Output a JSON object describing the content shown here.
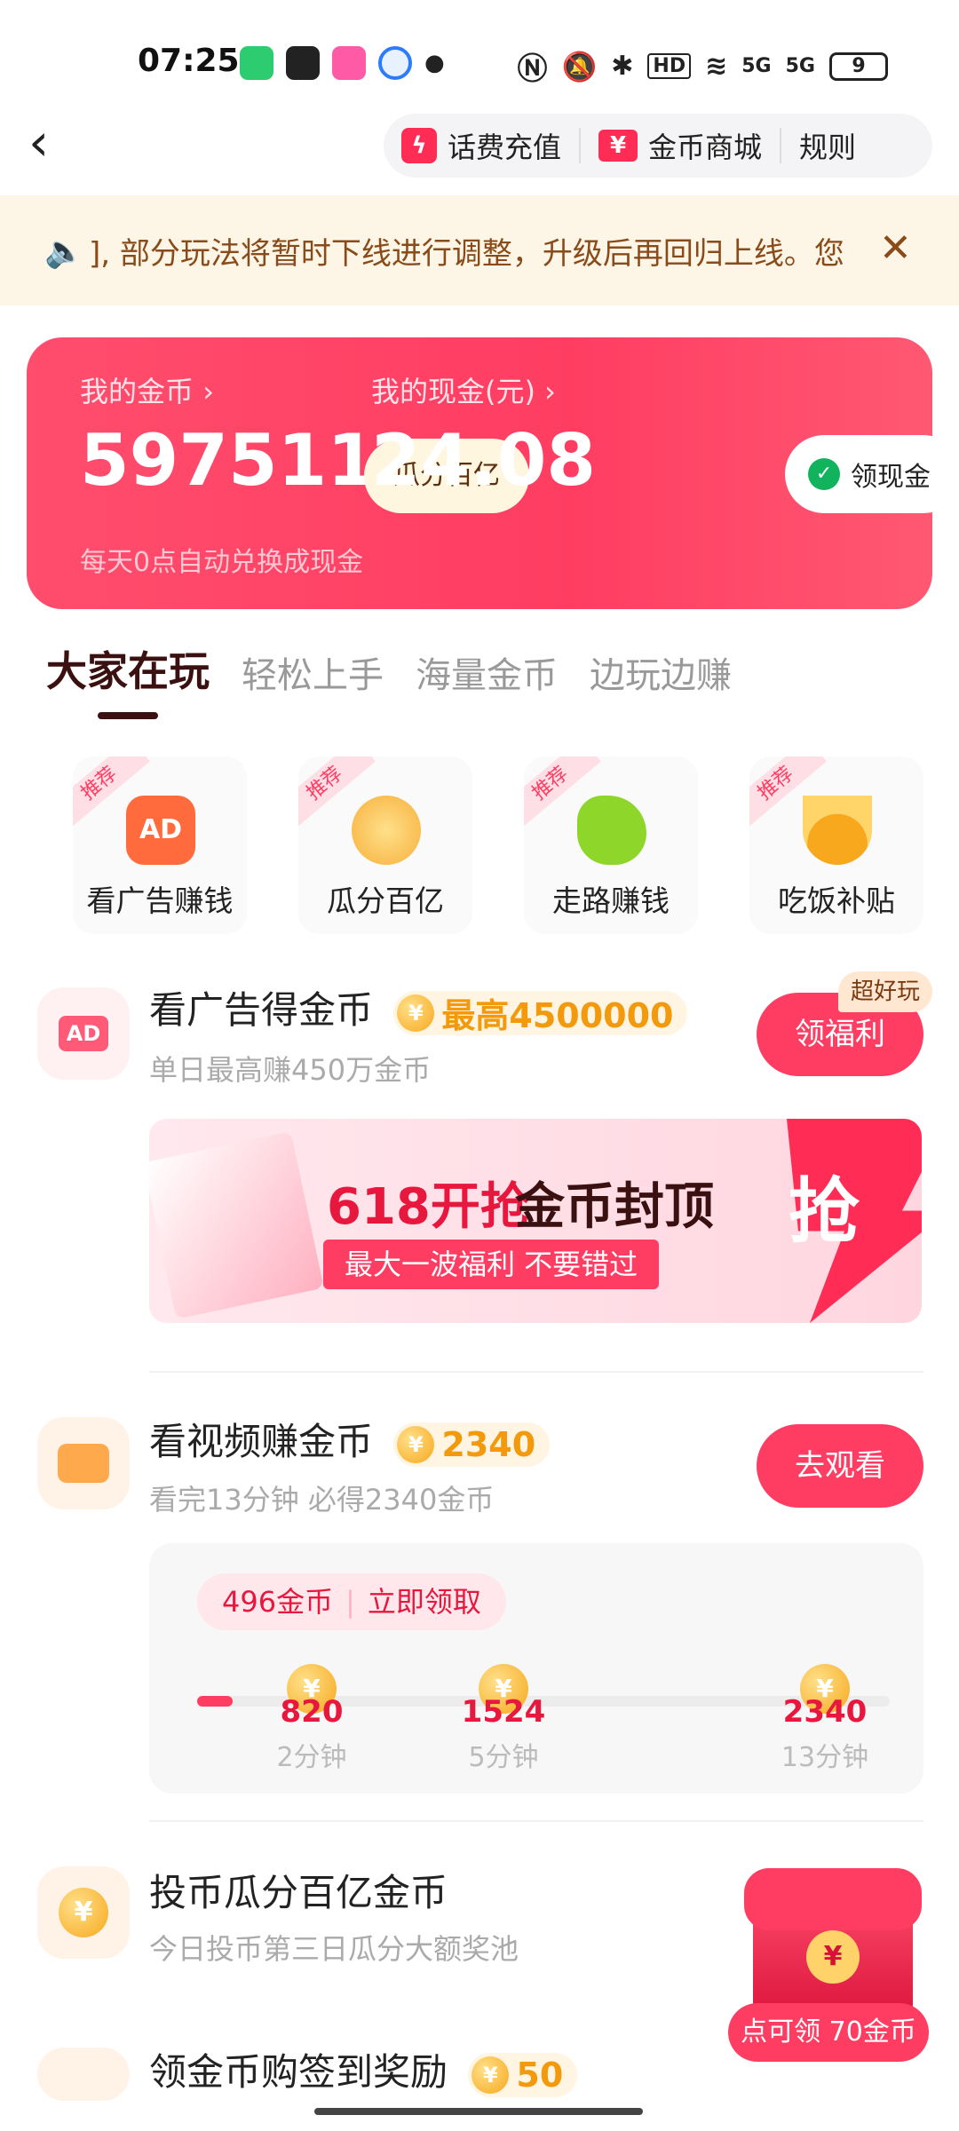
{
  "status_bar": {
    "time": "07:25",
    "right_labels": [
      "HD",
      "5G",
      "5G"
    ],
    "battery": "9"
  },
  "header": {
    "actions": [
      {
        "icon": "bolt-icon",
        "label": "话费充值"
      },
      {
        "icon": "yen-ticket-icon",
        "label": "金币商城"
      },
      {
        "label": "规则"
      }
    ]
  },
  "notice": {
    "text": "], 部分玩法将暂时下线进行调整，升级后再回归上线。您"
  },
  "wallet": {
    "coins_label": "我的金币",
    "coins_value": "597511",
    "split_pill": "瓜分百亿",
    "cash_label": "我的现金(元)",
    "cash_value": "24.08",
    "cash_button": "领现金",
    "subtitle": "每天0点自动兑换成现金"
  },
  "tabs": [
    "大家在玩",
    "轻松上手",
    "海量金币",
    "边玩边赚"
  ],
  "features": [
    {
      "tag": "推荐",
      "label": "看广告赚钱",
      "icon": "ad-tv-icon"
    },
    {
      "tag": "推荐",
      "label": "瓜分百亿",
      "icon": "coin-hand-icon"
    },
    {
      "tag": "推荐",
      "label": "走路赚钱",
      "icon": "runner-icon"
    },
    {
      "tag": "推荐",
      "label": "吃饭补贴",
      "icon": "food-bowl-icon"
    }
  ],
  "tasks": {
    "ads": {
      "title": "看广告得金币",
      "chip": "最高4500000",
      "subtitle": "单日最高赚450万金币",
      "button": "领福利",
      "badge": "超好玩",
      "icon_text": "AD"
    },
    "banner": {
      "headline_red": "618开抢",
      "headline_dark": "金币封顶",
      "subline": "最大一波福利 不要错过",
      "grab": "抢"
    },
    "video": {
      "title": "看视频赚金币",
      "chip": "2340",
      "subtitle": "看完13分钟 必得2340金币",
      "button": "去观看",
      "claim_coins": "496金币",
      "claim_action": "立即领取",
      "progress_fraction": 0.04,
      "milestones": [
        {
          "coins": "820",
          "time": "2分钟"
        },
        {
          "coins": "1524",
          "time": "5分钟"
        },
        {
          "coins": "2340",
          "time": "13分钟"
        }
      ]
    },
    "invest": {
      "title": "投币瓜分百亿金币",
      "subtitle": "今日投币第三日瓜分大额奖池"
    },
    "checkin": {
      "title": "领金币购签到奖励",
      "chip": "50"
    }
  },
  "float_reward": {
    "label": "点可领 70金币"
  },
  "colors": {
    "accent": "#ff3d62",
    "coin": "#f29a0c",
    "notice_bg": "#fdf6e6"
  }
}
